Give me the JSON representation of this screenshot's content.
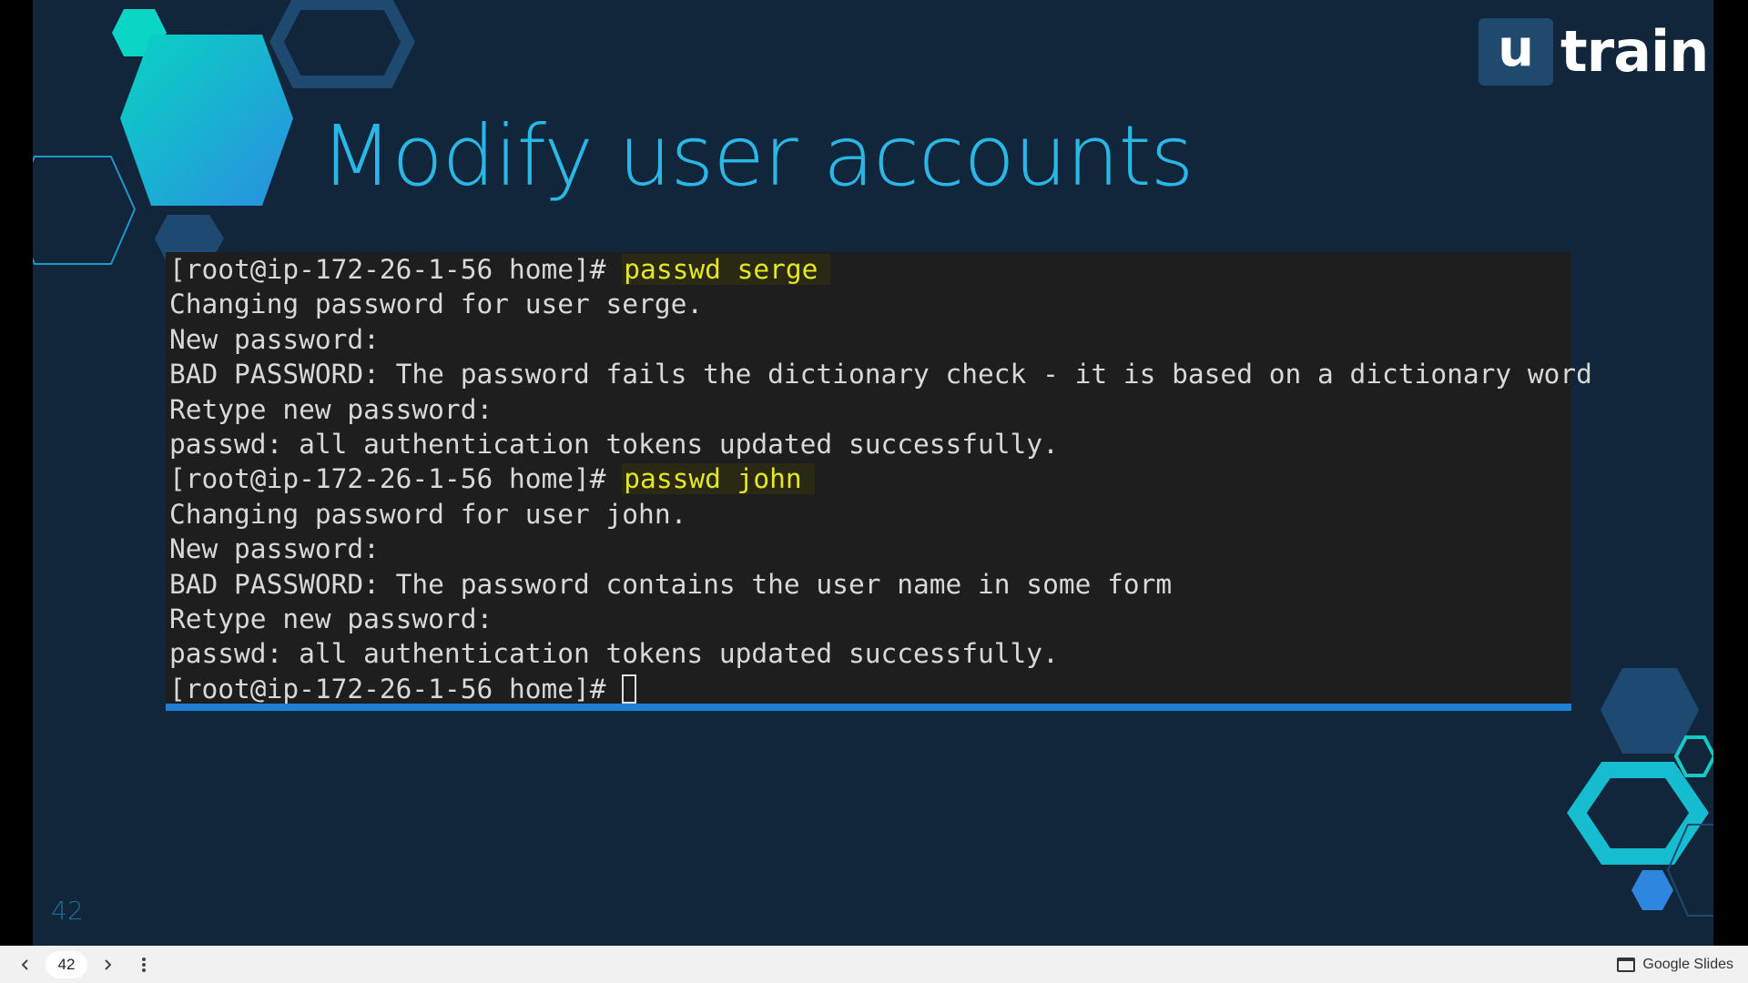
{
  "slide": {
    "title": "Modify user accounts",
    "number": "42",
    "logo": {
      "letter": "u",
      "word": "train"
    }
  },
  "terminal": {
    "lines": [
      {
        "prompt": "[root@ip-172-26-1-56 home]# ",
        "command": "passwd serge"
      },
      {
        "text": "Changing password for user serge."
      },
      {
        "text": "New password:"
      },
      {
        "text": "BAD PASSWORD: The password fails the dictionary check - it is based on a dictionary word"
      },
      {
        "text": "Retype new password:"
      },
      {
        "text": "passwd: all authentication tokens updated successfully."
      },
      {
        "prompt": "[root@ip-172-26-1-56 home]# ",
        "command": "passwd john"
      },
      {
        "text": "Changing password for user john."
      },
      {
        "text": "New password:"
      },
      {
        "text": "BAD PASSWORD: The password contains the user name in some form"
      },
      {
        "text": "Retype new password:"
      },
      {
        "text": "passwd: all authentication tokens updated successfully."
      },
      {
        "prompt": "[root@ip-172-26-1-56 home]# ",
        "command": ""
      }
    ]
  },
  "toolbar": {
    "prev_icon": "chevron-left-icon",
    "next_icon": "chevron-right-icon",
    "more_icon": "more-vertical-icon",
    "page": "42",
    "brand": "Google Slides"
  },
  "colors": {
    "slide_bg": "#11263a",
    "title": "#2bb7e6",
    "terminal_bg": "#1e1e1e",
    "command_highlight": "#e6e622",
    "accent": "#1f7fd6"
  }
}
